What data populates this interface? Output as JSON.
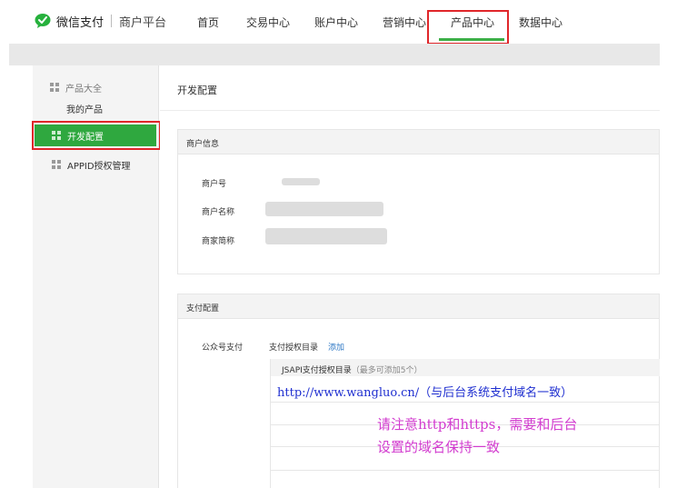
{
  "header": {
    "brand": "微信支付",
    "sub": "商户平台",
    "nav": [
      "首页",
      "交易中心",
      "账户中心",
      "营销中心",
      "产品中心",
      "数据中心"
    ],
    "active_nav": "产品中心"
  },
  "sidebar": {
    "section_title": "产品大全",
    "items": [
      {
        "label": "我的产品"
      },
      {
        "label": "开发配置"
      },
      {
        "label": "APPID授权管理"
      }
    ]
  },
  "main": {
    "page_title": "开发配置",
    "merchant_panel": {
      "title": "商户信息",
      "fields": [
        {
          "label": "商户号"
        },
        {
          "label": "商户名称"
        },
        {
          "label": "商家简称"
        }
      ]
    },
    "payment_panel": {
      "title": "支付配置",
      "row_label": "公众号支付",
      "dir_label": "支付授权目录",
      "add_label": "添加",
      "jsapi_title": "JSAPI支付授权目录",
      "jsapi_hint": "（最多可添加5个）"
    }
  },
  "annotations": {
    "url": "http://www.wangluo.cn/（与后台系统支付域名一致）",
    "note_line1": "请注意http和https，需要和后台",
    "note_line2": "设置的域名保持一致"
  },
  "colors": {
    "accent_green": "#2fa83f",
    "highlight_red": "#e0262a",
    "link_blue": "#2f79c5",
    "note_magenta": "#d23ccf",
    "url_blue": "#1f2fd0"
  }
}
